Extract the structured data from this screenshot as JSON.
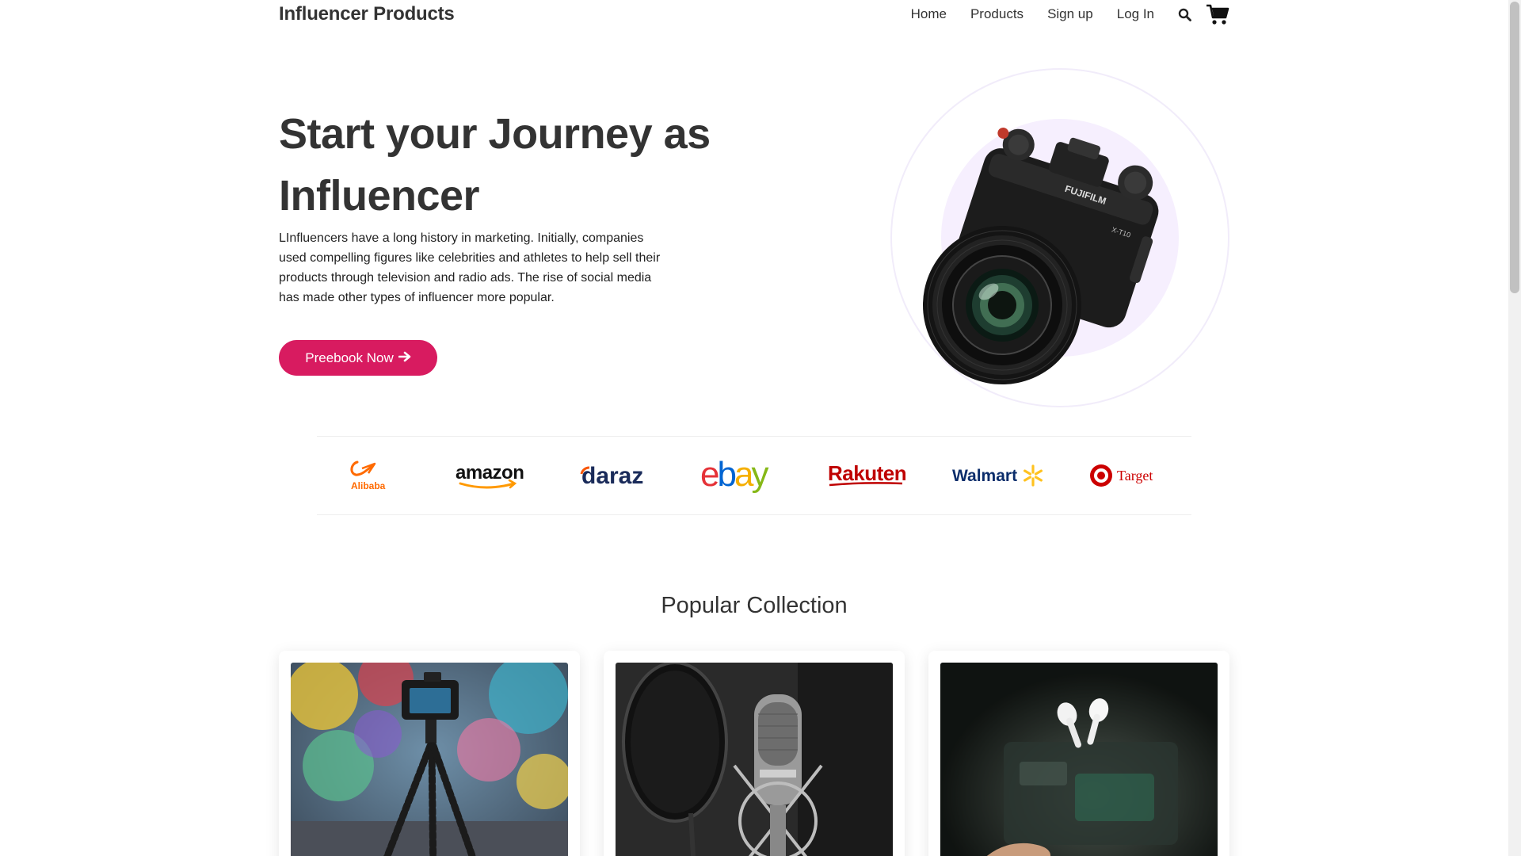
{
  "navbar": {
    "brand": "Influencer Products",
    "links": [
      "Home",
      "Products",
      "Sign up",
      "Log In"
    ],
    "icons": [
      "search-icon",
      "cart-icon"
    ]
  },
  "hero": {
    "title_line1": "Start your Journey as",
    "title_line2": "Influencer",
    "text": "LInfluencers have a long history in marketing. Initially, companies used compelling figures like celebrities and athletes to help sell their products through television and radio ads. The rise of social media has made other types of influencer more popular.",
    "cta_label": "Preebook Now",
    "camera_brand": "FUJIFILM",
    "camera_model": "X-T10"
  },
  "brands": {
    "alibaba": "Alibaba",
    "amazon": "amazon",
    "daraz": "daraz",
    "ebay_e": "e",
    "ebay_b": "b",
    "ebay_a": "a",
    "ebay_y": "y",
    "rakuten": "Rakuten",
    "walmart": "Walmart",
    "target": "Target"
  },
  "collection": {
    "title": "Popular Collection",
    "cards": [
      {
        "image": "camera-on-tripod"
      },
      {
        "image": "studio-microphone"
      },
      {
        "image": "floating-airpods"
      }
    ]
  },
  "colors": {
    "accent": "#d81b60",
    "text": "#333333",
    "circle": "#f6effe"
  }
}
